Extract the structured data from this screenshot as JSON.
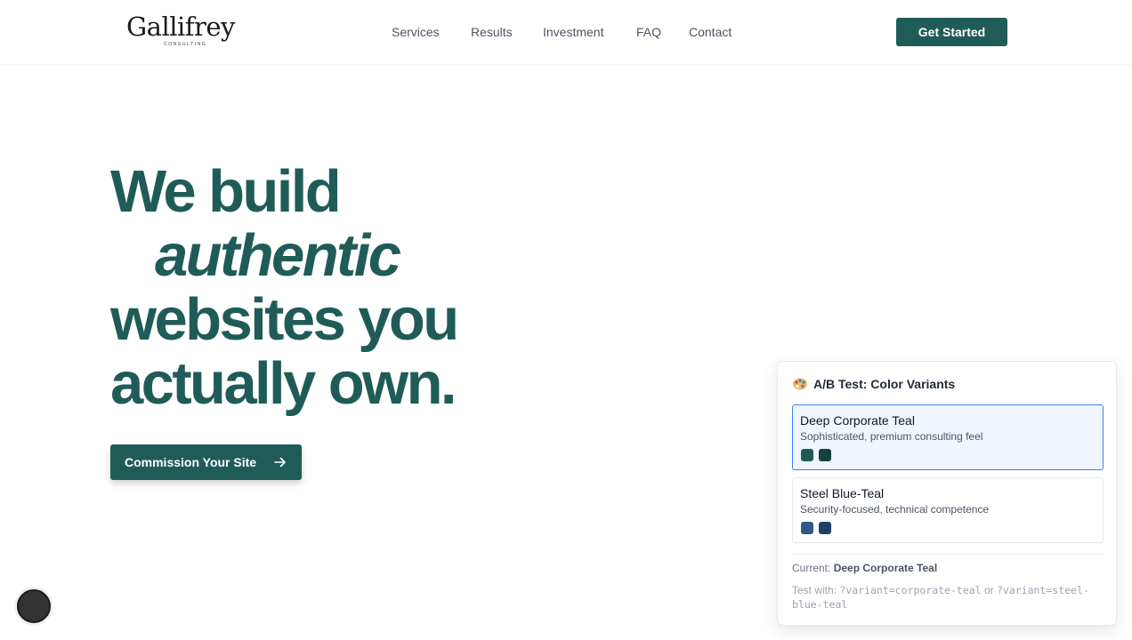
{
  "brand": {
    "name": "Gallifrey",
    "tagline": "CONSULTING"
  },
  "nav": {
    "items": [
      "Services",
      "Results",
      "Investment",
      "FAQ",
      "Contact"
    ],
    "cta": "Get Started"
  },
  "hero": {
    "line1": "We build",
    "line2": "authentic",
    "line3": "websites you",
    "line4": "actually own.",
    "button": "Commission Your Site",
    "button_icon": "arrow-right-icon"
  },
  "ab_panel": {
    "icon": "palette-icon",
    "title": "A/B Test: Color Variants",
    "variants": [
      {
        "name": "Deep Corporate Teal",
        "description": "Sophisticated, premium consulting feel",
        "swatches": [
          "#1f5c58",
          "#17403d"
        ],
        "selected": true
      },
      {
        "name": "Steel Blue-Teal",
        "description": "Security-focused, technical competence",
        "swatches": [
          "#2e5a8a",
          "#213f66"
        ],
        "selected": false
      }
    ],
    "current_label": "Current:",
    "current_value": "Deep Corporate Teal",
    "test_prefix": "Test with:",
    "test_code1": "?variant=corporate-teal",
    "test_or": "or",
    "test_code2": "?variant=steel-blue-teal"
  },
  "colors": {
    "primary": "#1f5c58",
    "selected_border": "#3b82f6",
    "selected_bg": "#eff6ff"
  }
}
